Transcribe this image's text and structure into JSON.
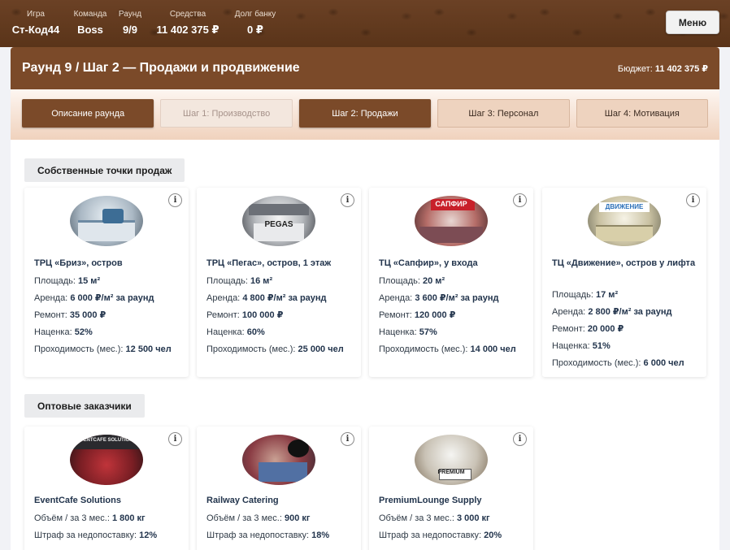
{
  "header": {
    "stats": [
      {
        "label": "Игра",
        "value": "Ст-Код44"
      },
      {
        "label": "Команда",
        "value": "Boss"
      },
      {
        "label": "Раунд",
        "value": "9/9"
      },
      {
        "label": "Средства",
        "value": "11 402 375 ₽"
      },
      {
        "label": "Долг банку",
        "value": "0 ₽"
      }
    ],
    "menu_label": "Меню"
  },
  "page": {
    "title": "Раунд 9 / Шаг 2 — Продажи и продвижение",
    "budget_label": "Бюджет:",
    "budget_value": "11 402 375 ₽"
  },
  "tabs": [
    {
      "label": "Описание раунда",
      "state": "active"
    },
    {
      "label": "Шаг 1: Производство",
      "state": "disabled"
    },
    {
      "label": "Шаг 2: Продажи",
      "state": "active"
    },
    {
      "label": "Шаг 3: Персонал",
      "state": "normal"
    },
    {
      "label": "Шаг 4: Мотивация",
      "state": "normal"
    }
  ],
  "sections": {
    "own_points": "Собственные точки продаж",
    "wholesale": "Оптовые заказчики"
  },
  "info_glyph": "i",
  "outlets": [
    {
      "name": "ТРЦ «Бриз», остров",
      "sign": "",
      "rows": [
        {
          "label": "Площадь:",
          "value": "15 м²"
        },
        {
          "label": "Аренда:",
          "value": "6 000 ₽/м² за раунд"
        },
        {
          "label": "Ремонт:",
          "value": "35 000 ₽"
        },
        {
          "label": "Наценка:",
          "value": "52%"
        },
        {
          "label": "Проходимость (мес.):",
          "value": "12 500 чел"
        }
      ]
    },
    {
      "name": "ТРЦ «Пегас», остров, 1 этаж",
      "sign": "PEGAS",
      "rows": [
        {
          "label": "Площадь:",
          "value": "16 м²"
        },
        {
          "label": "Аренда:",
          "value": "4 800 ₽/м² за раунд"
        },
        {
          "label": "Ремонт:",
          "value": "100 000 ₽"
        },
        {
          "label": "Наценка:",
          "value": "60%"
        },
        {
          "label": "Проходимость (мес.):",
          "value": "25 000 чел"
        }
      ]
    },
    {
      "name": "ТЦ «Сапфир», у входа",
      "sign": "САПФИР",
      "rows": [
        {
          "label": "Площадь:",
          "value": "20 м²"
        },
        {
          "label": "Аренда:",
          "value": "3 600 ₽/м² за раунд"
        },
        {
          "label": "Ремонт:",
          "value": "120 000 ₽"
        },
        {
          "label": "Наценка:",
          "value": "57%"
        },
        {
          "label": "Проходимость (мес.):",
          "value": "14 000 чел"
        }
      ]
    },
    {
      "name": "ТЦ «Движение», остров у лифта",
      "sign": "ДВИЖЕНИЕ",
      "rows": [
        {
          "label": "Площадь:",
          "value": "17 м²"
        },
        {
          "label": "Аренда:",
          "value": "2 800 ₽/м² за раунд"
        },
        {
          "label": "Ремонт:",
          "value": "20 000 ₽"
        },
        {
          "label": "Наценка:",
          "value": "51%"
        },
        {
          "label": "Проходимость (мес.):",
          "value": "6 000 чел"
        }
      ]
    }
  ],
  "customers": [
    {
      "name": "EventCafe Solutions",
      "sign": "EVENTCAFE SOLUTIONS",
      "rows": [
        {
          "label": "Объём / за 3 мес.:",
          "value": "1 800 кг"
        },
        {
          "label": "Штраф за недопоставку:",
          "value": "12%"
        }
      ]
    },
    {
      "name": "Railway Catering",
      "sign": "",
      "rows": [
        {
          "label": "Объём / за 3 мес.:",
          "value": "900 кг"
        },
        {
          "label": "Штраф за недопоставку:",
          "value": "18%"
        }
      ]
    },
    {
      "name": "PremiumLounge Supply",
      "sign": "PREMIUM",
      "rows": [
        {
          "label": "Объём / за 3 мес.:",
          "value": "3 000 кг"
        },
        {
          "label": "Штраф за недопоставку:",
          "value": "20%"
        }
      ]
    }
  ]
}
